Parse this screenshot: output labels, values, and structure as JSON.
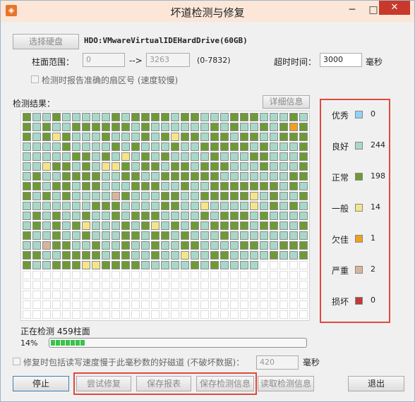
{
  "window": {
    "title": "坏道检测与修复",
    "app_icon": "app-icon-orange",
    "controls": {
      "minimize": "─",
      "maximize": "□",
      "close": "✕"
    }
  },
  "disk": {
    "select_label": "选择硬盘",
    "name": "HDO:VMwareVirtualIDEHardDrive(60GB)"
  },
  "range": {
    "label": "柱面范围：",
    "start": "0",
    "arrow": "-->",
    "end": "3263",
    "bounds": "(0-7832)"
  },
  "timeout": {
    "label": "超时时间：",
    "value": "3000",
    "unit": "毫秒"
  },
  "report_sector_checkbox": {
    "label": "检测时报告准确的扇区号 (速度较慢)",
    "checked": false
  },
  "results": {
    "label": "检测结果：",
    "detail_button": "详细信息"
  },
  "legend": [
    {
      "name": "优秀",
      "count": "0",
      "color": "#8fd3f4"
    },
    {
      "name": "良好",
      "count": "244",
      "color": "#a8d8c8"
    },
    {
      "name": "正常",
      "count": "198",
      "color": "#6e9a35"
    },
    {
      "name": "一般",
      "count": "14",
      "color": "#f5e58a"
    },
    {
      "name": "欠佳",
      "count": "1",
      "color": "#f0a020"
    },
    {
      "name": "严重",
      "count": "2",
      "color": "#d8b49e"
    },
    {
      "name": "损坏",
      "count": "0",
      "color": "#c0393b"
    }
  ],
  "status": {
    "text": "正在检测 459柱面",
    "percent_label": "14%",
    "progress": 0.14
  },
  "repair_option": {
    "label": "修复时包括读写速度慢于此毫秒数的好磁道 (不破坏数据)：",
    "value": "420",
    "unit": "毫秒",
    "checked": false
  },
  "buttons": {
    "stop": "停止",
    "try_repair": "尝试修复",
    "save_report": "保存报表",
    "save_info": "保存检测信息",
    "read_info": "读取检测信息",
    "exit": "退出"
  },
  "grid_data": {
    "columns": 29,
    "total_rows": 21,
    "scanned_count": 459,
    "color_map": {
      "g": "#a8d8c8",
      "o": "#6e9a35",
      "y": "#f5e58a",
      "a": "#f0a020",
      "s": "#d8b49e",
      "w": "#ffffff"
    }
  }
}
